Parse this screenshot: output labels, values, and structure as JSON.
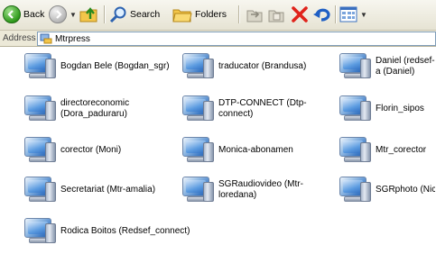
{
  "toolbar": {
    "back_label": "Back",
    "search_label": "Search",
    "folders_label": "Folders"
  },
  "address": {
    "label": "Address",
    "value": "Mtrpress"
  },
  "items": [
    {
      "name": "Bogdan Bele (Bogdan_sgr)"
    },
    {
      "name": "traducator (Brandusa)"
    },
    {
      "name": "Daniel (redsef-a (Daniel)"
    },
    {
      "name": "directoreconomic (Dora_paduraru)"
    },
    {
      "name": "DTP-CONNECT (Dtp-connect)"
    },
    {
      "name": "Florin_sipos"
    },
    {
      "name": "corector (Moni)"
    },
    {
      "name": "Monica-abonamen"
    },
    {
      "name": "Mtr_corector"
    },
    {
      "name": "Secretariat (Mtr-amalia)"
    },
    {
      "name": "SGRaudiovideo (Mtr-loredana)"
    },
    {
      "name": "SGRphoto (Nick)"
    },
    {
      "name": "Rodica Boitos (Redsef_connect)"
    }
  ]
}
